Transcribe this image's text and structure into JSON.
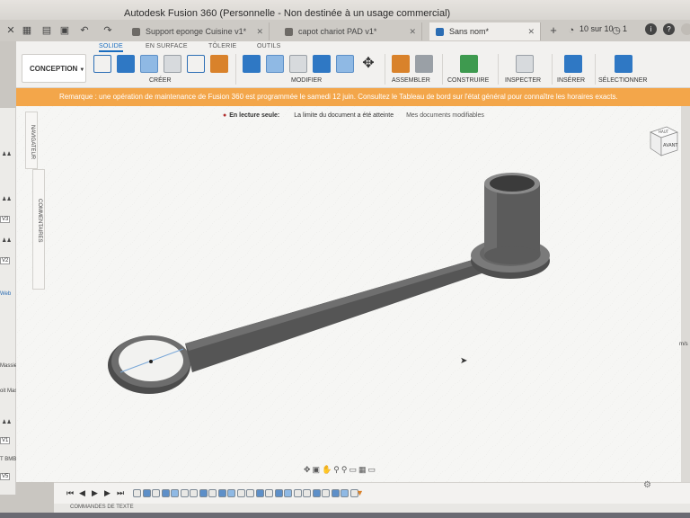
{
  "app": {
    "title": "Autodesk Fusion 360 (Personnelle - Non destinée à un usage commercial)"
  },
  "tabs": [
    {
      "label": "Support eponge Cuisine v1*",
      "active": false
    },
    {
      "label": "capot chariot PAD v1*",
      "active": false
    },
    {
      "label": "Sans nom*",
      "active": true
    }
  ],
  "tabbar_right": {
    "job_status": "10 sur 10",
    "notifications": "1"
  },
  "ribbon": {
    "tabs": [
      "SOLIDE",
      "EN SURFACE",
      "TÔLERIE",
      "OUTILS"
    ],
    "active_tab": "SOLIDE",
    "workspace": "CONCEPTION",
    "groups": [
      "CRÉER",
      "MODIFIER",
      "ASSEMBLER",
      "CONSTRUIRE",
      "INSPECTER",
      "INSÉRER",
      "SÉLECTIONNER"
    ]
  },
  "banner": {
    "text": "Remarque : une opération de maintenance de Fusion 360 est programmée le samedi 12 juin. Consultez le Tableau de bord sur l'état général pour connaître les horaires exacts."
  },
  "readonly_bar": {
    "label": "En lecture seule:",
    "message": "La limite du document a été atteinte",
    "link": "Mes documents modifiables"
  },
  "side_panels": {
    "navigator": "NAVIGATEUR",
    "comments": "COMMENTAIRES"
  },
  "viewcube": {
    "face_top": "HAUT",
    "face_front": "AVANT"
  },
  "left_strip": {
    "items": [
      "V3",
      "V2",
      "Web",
      "Massiet",
      "oit Massiet",
      "V1",
      "T BMB",
      "V5"
    ]
  },
  "right_strip": {
    "items": [
      "m/s",
      "ms"
    ]
  },
  "command_bar": {
    "label": "COMMANDES DE TEXTE"
  },
  "timeline": {
    "steps": 24
  },
  "colors": {
    "accent": "#1a6dbf",
    "banner": "#f3a64a",
    "model": "#5a5a5a",
    "viewport": "#f6f6f4"
  }
}
